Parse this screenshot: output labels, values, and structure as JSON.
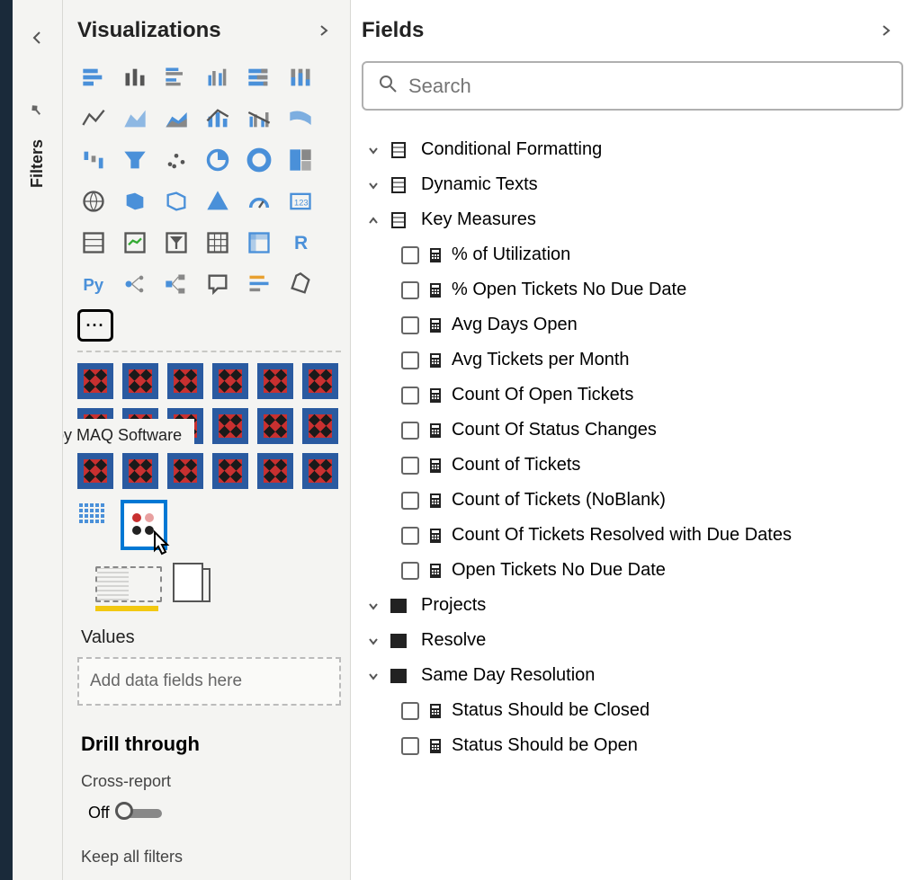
{
  "filters": {
    "label": "Filters"
  },
  "visualizations": {
    "title": "Visualizations",
    "tooltip": "Dot Plot by MAQ Software",
    "values_label": "Values",
    "drop_placeholder": "Add data fields here",
    "drill_title": "Drill through",
    "cross_report_label": "Cross-report",
    "toggle_state": "Off",
    "keep_filters_label": "Keep all filters"
  },
  "fields": {
    "title": "Fields",
    "search_placeholder": "Search",
    "tables": [
      {
        "name": "Conditional Formatting",
        "type": "table",
        "expanded": false,
        "children": []
      },
      {
        "name": "Dynamic Texts",
        "type": "table",
        "expanded": false,
        "children": []
      },
      {
        "name": "Key Measures",
        "type": "table",
        "expanded": true,
        "children": [
          {
            "name": "% of Utilization",
            "type": "measure",
            "checked": false
          },
          {
            "name": "% Open Tickets No Due Date",
            "type": "measure",
            "checked": false
          },
          {
            "name": "Avg Days Open",
            "type": "measure",
            "checked": false
          },
          {
            "name": "Avg Tickets per Month",
            "type": "measure",
            "checked": false
          },
          {
            "name": "Count Of Open Tickets",
            "type": "measure",
            "checked": false
          },
          {
            "name": "Count Of Status Changes",
            "type": "measure",
            "checked": false
          },
          {
            "name": "Count of Tickets",
            "type": "measure",
            "checked": false
          },
          {
            "name": "Count of Tickets (NoBlank)",
            "type": "measure",
            "checked": false
          },
          {
            "name": "Count Of Tickets Resolved with Due Dates",
            "type": "measure",
            "checked": false
          },
          {
            "name": "Open Tickets No Due Date",
            "type": "measure",
            "checked": false
          }
        ]
      },
      {
        "name": "Projects",
        "type": "folder",
        "expanded": false,
        "children": []
      },
      {
        "name": "Resolve",
        "type": "folder",
        "expanded": false,
        "children": []
      },
      {
        "name": "Same Day Resolution",
        "type": "folder",
        "expanded": false,
        "children": [
          {
            "name": "Status Should be Closed",
            "type": "measure",
            "checked": false
          },
          {
            "name": "Status Should be Open",
            "type": "measure",
            "checked": false
          }
        ]
      }
    ]
  }
}
